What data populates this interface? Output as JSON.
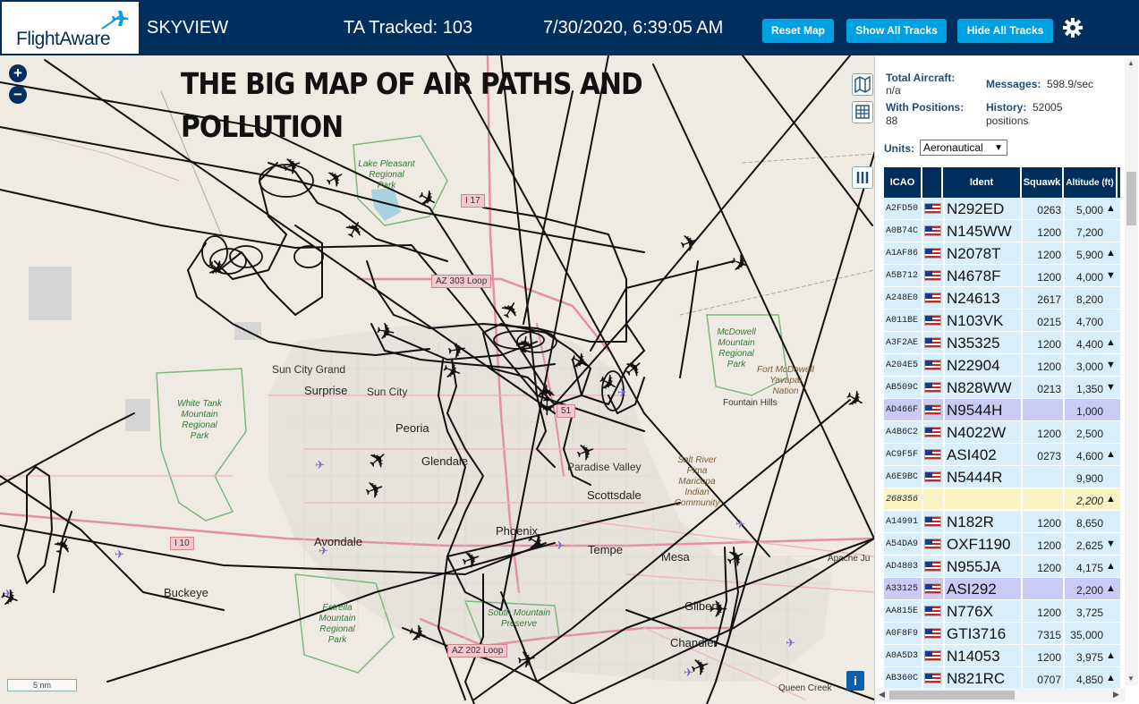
{
  "header": {
    "logo_text": "FlightAware",
    "title": "SKYVIEW",
    "ta_tracked": "TA Tracked: 103",
    "datetime": "7/30/2020, 6:39:05 AM",
    "buttons": {
      "reset": "Reset Map",
      "show": "Show All Tracks",
      "hide": "Hide All Tracks"
    },
    "colors": {
      "bar": "#002f5d",
      "button": "#00a0e2"
    }
  },
  "map": {
    "headline_line1": "THE BIG MAP OF AIR PATHS AND",
    "headline_line2": "POLLUTION",
    "zoom_in": "+",
    "zoom_out": "−",
    "scale": "5 nm",
    "info": "i",
    "places": {
      "sun_city_grand": "Sun City Grand",
      "surprise": "Surprise",
      "sun_city": "Sun City",
      "peoria": "Peoria",
      "glendale": "Glendale",
      "paradise_valley": "Paradise Valley",
      "scottsdale": "Scottsdale",
      "avondale": "Avondale",
      "buckeye": "Buckeye",
      "phoenix": "Phoenix",
      "tempe": "Tempe",
      "mesa": "Mesa",
      "gilbert": "Gilbert",
      "chandler": "Chandler",
      "fountain_hills": "Fountain Hills",
      "apache_junction": "Apache Ju",
      "queen_creek": "Queen Creek"
    },
    "parks": {
      "lake_pleasant": [
        "Lake Pleasant",
        "Regional",
        "Park"
      ],
      "white_tank": [
        "White Tank",
        "Mountain",
        "Regional",
        "Park"
      ],
      "mcdowell": [
        "McDowell",
        "Mountain",
        "Regional",
        "Park"
      ],
      "estrella": [
        "Estrella",
        "Mountain",
        "Regional",
        "Park"
      ],
      "south_mountain": [
        "South Mountain",
        "Preserve"
      ]
    },
    "reservations": {
      "fort_mcdowell": [
        "Fort McDowell",
        "Yavapai",
        "Nation"
      ],
      "salt_river": [
        "Salt River",
        "Pima",
        "Maricopa",
        "Indian",
        "Community"
      ]
    },
    "roads": {
      "i17": "I 17",
      "az303": "AZ 303 Loop",
      "i10": "I 10",
      "az202": "AZ 202 Loop",
      "az51": "51"
    }
  },
  "sidebar": {
    "total_aircraft_label": "Total Aircraft:",
    "total_aircraft_value": "n/a",
    "messages_label": "Messages:",
    "messages_value": "598.9/sec",
    "with_positions_label": "With Positions:",
    "with_positions_value": "88",
    "history_label": "History:",
    "history_value": "52005",
    "history_unit": "positions",
    "units_label": "Units:",
    "units_value": "Aeronautical",
    "columns": {
      "icao": "ICAO",
      "ident": "Ident",
      "squawk": "Squawk",
      "altitude": "Altitude (ft)"
    },
    "rows": [
      {
        "icao": "A2FD50",
        "ident": "N292ED",
        "squawk": "0263",
        "alt": "5,000",
        "arrow": "▲",
        "style": "",
        "flag": true
      },
      {
        "icao": "A0B74C",
        "ident": "N145WW",
        "squawk": "1200",
        "alt": "7,200",
        "arrow": "",
        "style": "",
        "flag": true
      },
      {
        "icao": "A1AF86",
        "ident": "N2078T",
        "squawk": "1200",
        "alt": "5,900",
        "arrow": "▲",
        "style": "",
        "flag": true
      },
      {
        "icao": "A5B712",
        "ident": "N4678F",
        "squawk": "1200",
        "alt": "4,000",
        "arrow": "▼",
        "style": "",
        "flag": true
      },
      {
        "icao": "A248E0",
        "ident": "N24613",
        "squawk": "2617",
        "alt": "8,200",
        "arrow": "",
        "style": "",
        "flag": true
      },
      {
        "icao": "A011BE",
        "ident": "N103VK",
        "squawk": "0215",
        "alt": "4,700",
        "arrow": "",
        "style": "",
        "flag": true
      },
      {
        "icao": "A3F2AE",
        "ident": "N35325",
        "squawk": "1200",
        "alt": "4,400",
        "arrow": "▲",
        "style": "",
        "flag": true
      },
      {
        "icao": "A204E5",
        "ident": "N22904",
        "squawk": "1200",
        "alt": "3,000",
        "arrow": "▼",
        "style": "",
        "flag": true
      },
      {
        "icao": "AB509C",
        "ident": "N828WW",
        "squawk": "0213",
        "alt": "1,350",
        "arrow": "▼",
        "style": "",
        "flag": true
      },
      {
        "icao": "AD466F",
        "ident": "N9544H",
        "squawk": "",
        "alt": "1,000",
        "arrow": "",
        "style": "sel",
        "flag": true
      },
      {
        "icao": "A4B6C2",
        "ident": "N4022W",
        "squawk": "1200",
        "alt": "2,500",
        "arrow": "",
        "style": "",
        "flag": true
      },
      {
        "icao": "AC9F5F",
        "ident": "ASI402",
        "squawk": "0273",
        "alt": "4,600",
        "arrow": "▲",
        "style": "",
        "flag": true
      },
      {
        "icao": "A6E9BC",
        "ident": "N5444R",
        "squawk": "",
        "alt": "9,900",
        "arrow": "",
        "style": "",
        "flag": true
      },
      {
        "icao": "268356",
        "ident": "",
        "squawk": "",
        "alt": "2,200",
        "arrow": "▲",
        "style": "yel",
        "flag": false
      },
      {
        "icao": "A14991",
        "ident": "N182R",
        "squawk": "1200",
        "alt": "8,650",
        "arrow": "",
        "style": "",
        "flag": true
      },
      {
        "icao": "A54DA9",
        "ident": "OXF1190",
        "squawk": "1200",
        "alt": "2,625",
        "arrow": "▼",
        "style": "",
        "flag": true
      },
      {
        "icao": "AD4803",
        "ident": "N955JA",
        "squawk": "1200",
        "alt": "4,175",
        "arrow": "▲",
        "style": "",
        "flag": true
      },
      {
        "icao": "A33125",
        "ident": "ASI292",
        "squawk": "",
        "alt": "2,200",
        "arrow": "▲",
        "style": "sel",
        "flag": true
      },
      {
        "icao": "AA815E",
        "ident": "N776X",
        "squawk": "1200",
        "alt": "3,725",
        "arrow": "",
        "style": "",
        "flag": true
      },
      {
        "icao": "A0F8F9",
        "ident": "GTI3716",
        "squawk": "7315",
        "alt": "35,000",
        "arrow": "",
        "style": "",
        "flag": true
      },
      {
        "icao": "A0A5D3",
        "ident": "N14053",
        "squawk": "1200",
        "alt": "3,975",
        "arrow": "▲",
        "style": "",
        "flag": true
      },
      {
        "icao": "AB360C",
        "ident": "N821RC",
        "squawk": "0707",
        "alt": "4,850",
        "arrow": "▲",
        "style": "",
        "flag": true
      }
    ]
  }
}
